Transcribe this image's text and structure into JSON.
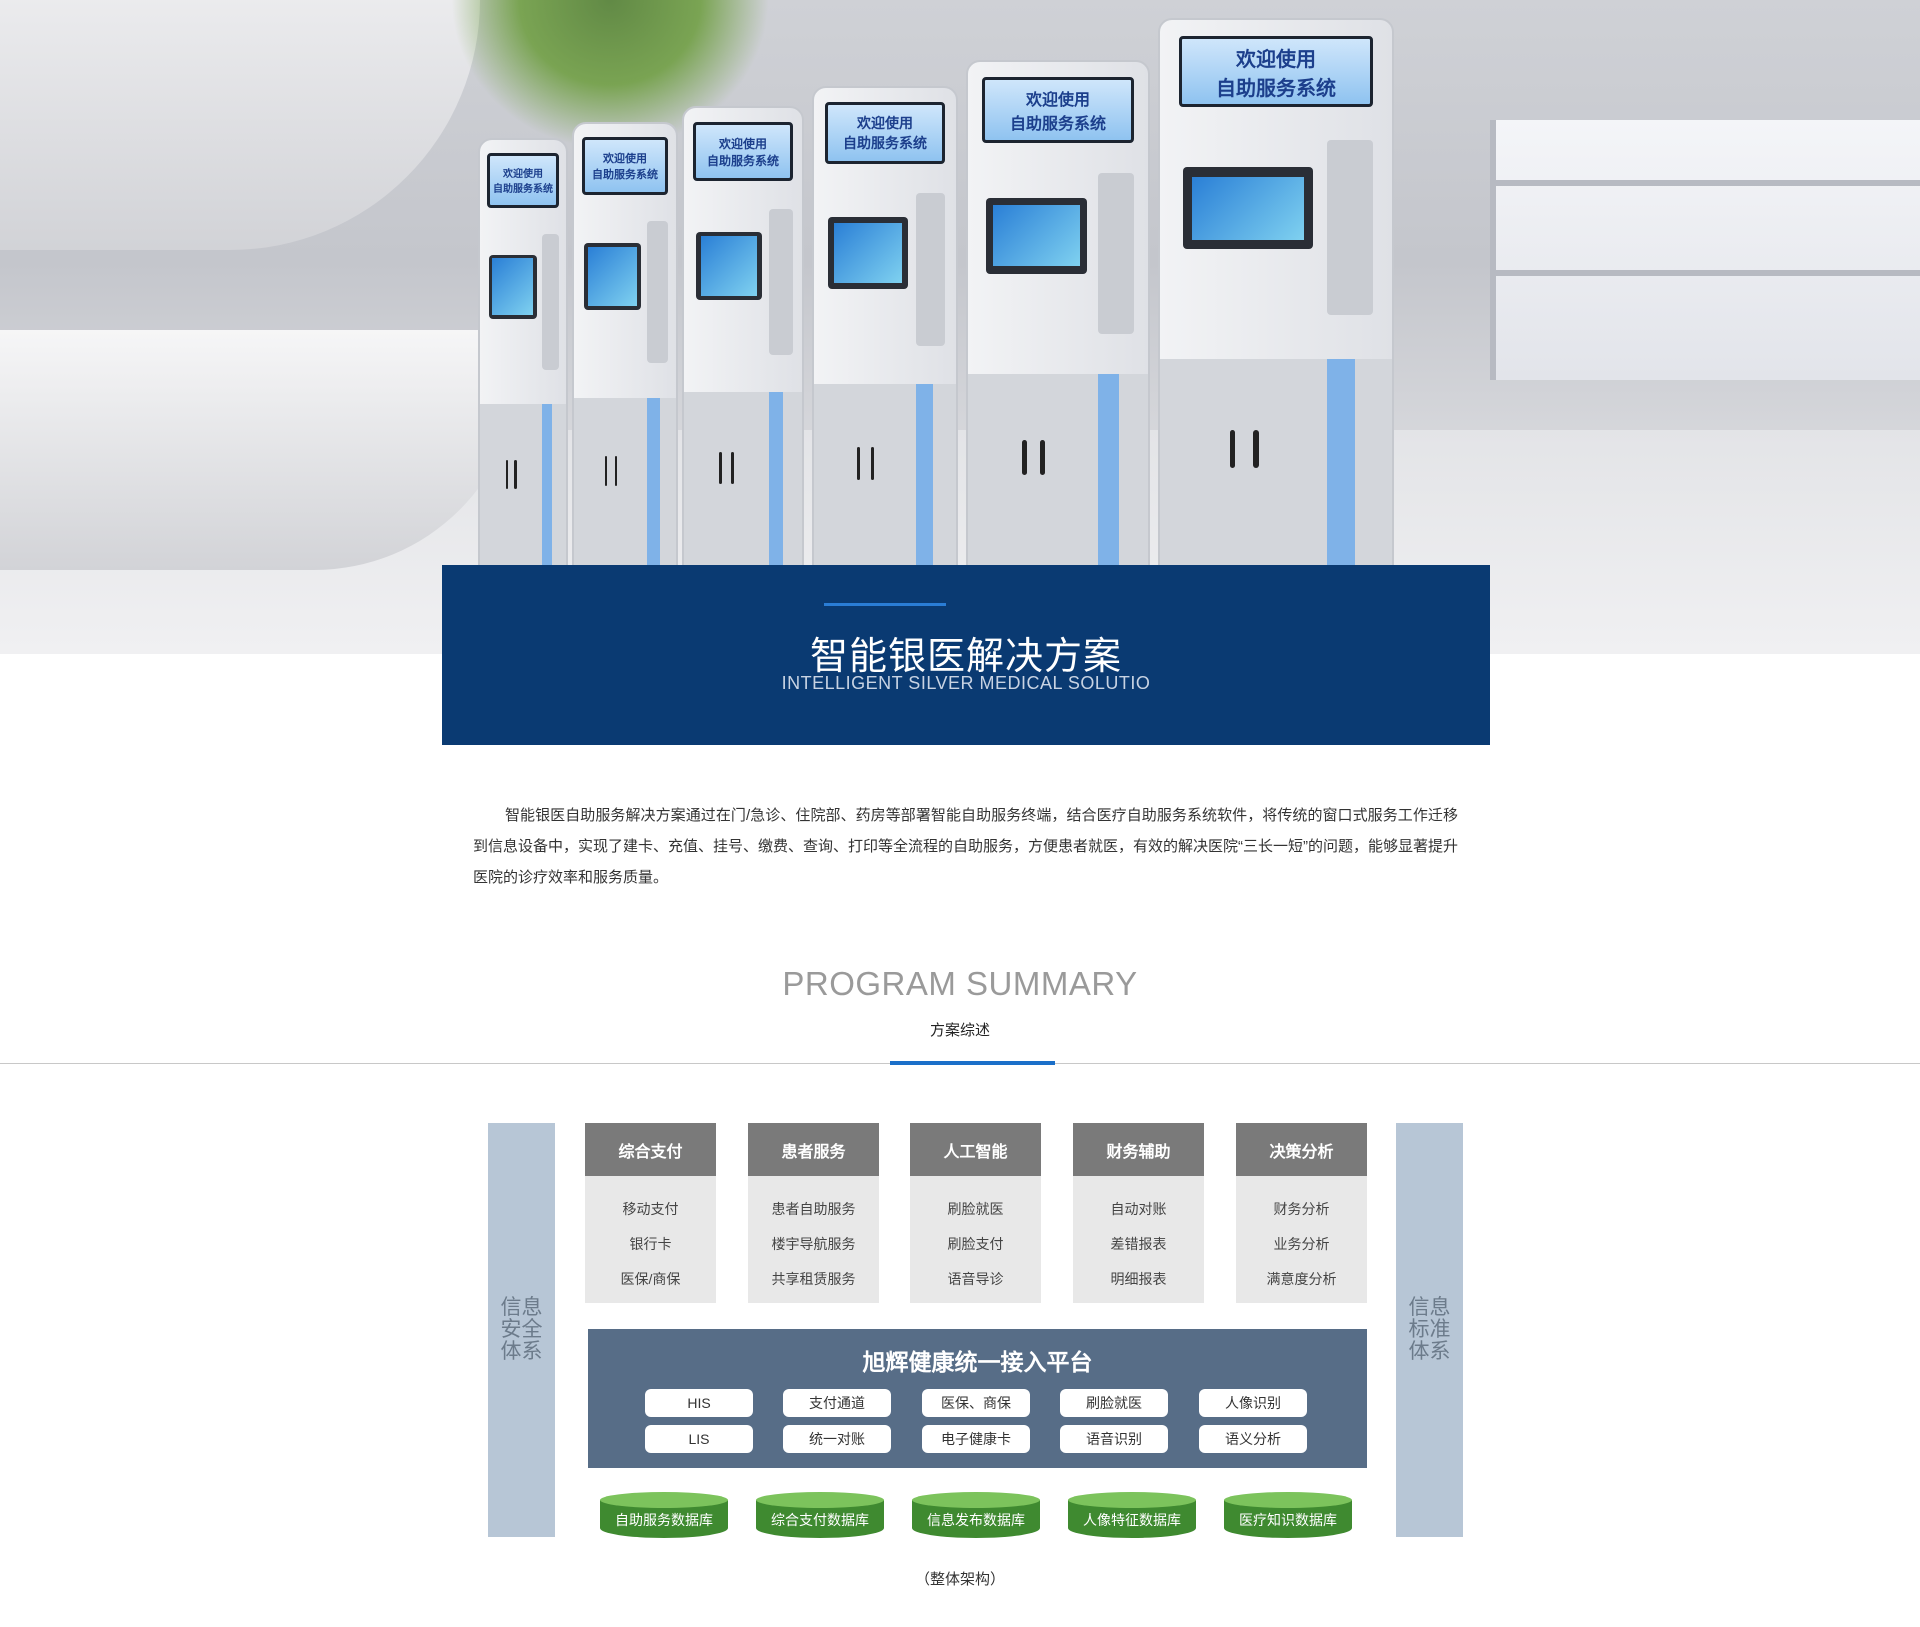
{
  "hero": {
    "kiosk_signs": [
      {
        "line1": "欢迎使用",
        "line2": "自助服务系统"
      },
      {
        "line1": "欢迎使用",
        "line2": "自助服务系统"
      },
      {
        "line1": "欢迎使用",
        "line2": "自助服务系统"
      },
      {
        "line1": "欢迎使用",
        "line2": "自助服务系统"
      },
      {
        "line1": "欢迎使用",
        "line2": "自助服务系统"
      },
      {
        "line1": "欢迎使用",
        "line2": "自助服务系统"
      }
    ]
  },
  "title_card": {
    "title": "智能银医解决方案",
    "subtitle": "INTELLIGENT SILVER MEDICAL SOLUTIO"
  },
  "intro": {
    "text": "智能银医自助服务解决方案通过在门/急诊、住院部、药房等部署智能自助服务终端，结合医疗自助服务系统软件，将传统的窗口式服务工作迁移到信息设备中，实现了建卡、充值、挂号、缴费、查询、打印等全流程的自助服务，方便患者就医，有效的解决医院“三长一短”的问题，能够显著提升医院的诊疗效率和服务质量。"
  },
  "summary": {
    "title_en": "PROGRAM SUMMARY",
    "title_cn": "方案综述"
  },
  "architecture": {
    "left_column": "信息安全体系",
    "right_column": "信息标准体系",
    "modules": [
      {
        "title": "综合支付",
        "items": [
          "移动支付",
          "银行卡",
          "医保/商保"
        ]
      },
      {
        "title": "患者服务",
        "items": [
          "患者自助服务",
          "楼宇导航服务",
          "共享租赁服务"
        ]
      },
      {
        "title": "人工智能",
        "items": [
          "刷脸就医",
          "刷脸支付",
          "语音导诊"
        ]
      },
      {
        "title": "财务辅助",
        "items": [
          "自动对账",
          "差错报表",
          "明细报表"
        ]
      },
      {
        "title": "决策分析",
        "items": [
          "财务分析",
          "业务分析",
          "满意度分析"
        ]
      }
    ],
    "platform": {
      "title": "旭辉健康统一接入平台",
      "chips_row1": [
        "HIS",
        "支付通道",
        "医保、商保",
        "刷脸就医",
        "人像识别"
      ],
      "chips_row2": [
        "LIS",
        "统一对账",
        "电子健康卡",
        "语音识别",
        "语义分析"
      ]
    },
    "databases": [
      "自助服务数据库",
      "综合支付数据库",
      "信息发布数据库",
      "人像特征数据库",
      "医疗知识数据库"
    ],
    "caption": "（整体架构）"
  },
  "colors": {
    "title_card_bg": "#0a3a72",
    "accent_blue": "#1b6fc9",
    "platform_bg": "#576d87",
    "module_head": "#7a7a7a",
    "side_column": "#b7c6d6",
    "db_green": "#3f8a30"
  }
}
